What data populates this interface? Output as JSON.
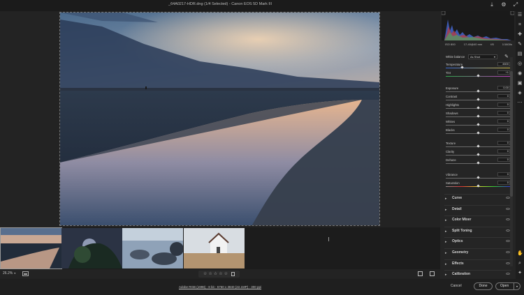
{
  "window": {
    "title": "_64A0217-HDR.dng (1/4 Selected)  -  Canon EOS 5D Mark III"
  },
  "titlebar_icons": [
    "export-icon",
    "gear-icon",
    "expand-icon"
  ],
  "camera_info": [
    "ISO 800",
    "17-40@40 mm",
    "f/8",
    "1/1600s"
  ],
  "white_balance": {
    "label": "White balance",
    "value": "As Shot"
  },
  "sliders": [
    {
      "label": "Temperature",
      "value": "4600",
      "pos": 0.25
    },
    {
      "label": "Tint",
      "value": "+1",
      "pos": 0.5
    },
    {
      "label": "Exposure",
      "value": "0.00",
      "pos": 0.5
    },
    {
      "label": "Contrast",
      "value": "0",
      "pos": 0.5
    },
    {
      "label": "Highlights",
      "value": "0",
      "pos": 0.5
    },
    {
      "label": "Shadows",
      "value": "0",
      "pos": 0.5
    },
    {
      "label": "Whites",
      "value": "0",
      "pos": 0.5
    },
    {
      "label": "Blacks",
      "value": "0",
      "pos": 0.5
    },
    {
      "label": "Texture",
      "value": "0",
      "pos": 0.5
    },
    {
      "label": "Clarity",
      "value": "0",
      "pos": 0.5
    },
    {
      "label": "Dehaze",
      "value": "0",
      "pos": 0.5
    },
    {
      "label": "Vibrance",
      "value": "0",
      "pos": 0.5
    },
    {
      "label": "Saturation",
      "value": "0",
      "pos": 0.5
    }
  ],
  "sections": [
    "Curve",
    "Detail",
    "Color Mixer",
    "Split Toning",
    "Optics",
    "Geometry",
    "Effects",
    "Calibration"
  ],
  "zoom": {
    "value": "26.2%"
  },
  "rating_stars": 5,
  "workflow": "Adobe RGB (1998) - 8 bit - 5760 x 3840 (22.1MP) - 300 ppi",
  "buttons": {
    "cancel": "Cancel",
    "done": "Done",
    "open": "Open"
  },
  "tool_rail": [
    "edit-icon",
    "crop-icon",
    "healing-icon",
    "brush-icon",
    "graduated-filter-icon",
    "radial-filter-icon",
    "redeye-icon",
    "snapshots-icon",
    "presets-icon",
    "more-icon",
    "hand-icon",
    "zoom-icon",
    "sampler-icon"
  ],
  "colors": {
    "accent": "#2a82da",
    "panel": "#252525",
    "background": "#202020"
  }
}
